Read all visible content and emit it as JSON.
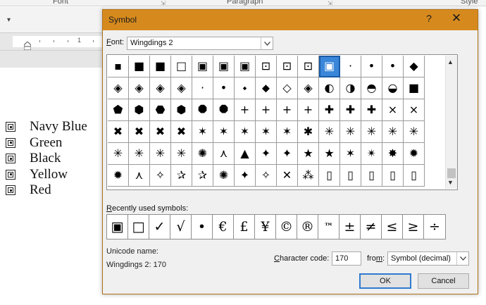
{
  "ribbon": {
    "groups": [
      "Font",
      "Paragraph",
      "Style"
    ],
    "collapse_icon": "qat-chevron-icon"
  },
  "ruler": {
    "number": "1"
  },
  "document": {
    "bullets": [
      "Navy Blue",
      "Green",
      "Black",
      "Yellow",
      "Red"
    ],
    "bullet_icon": "wingdings2-boxed-square-icon"
  },
  "dialog": {
    "title": "Symbol",
    "help_label": "?",
    "close_label": "✕",
    "font_label_u": "F",
    "font_label_rest": "ont:",
    "font_value": "Wingdings 2",
    "recent_label_u": "R",
    "recent_label_rest": "ecently used symbols:",
    "unicode_name_label": "Unicode name:",
    "unicode_name_value": "Wingdings 2: 170",
    "char_code_label_u": "C",
    "char_code_label_rest": "haracter code:",
    "char_code_value": "170",
    "from_label_rest": "fro",
    "from_label_u": "m",
    "from_label_end": ":",
    "from_value": "Symbol (decimal)",
    "ok_label": "OK",
    "cancel_label": "Cancel"
  },
  "symbols": [
    [
      "▪",
      "■",
      "■",
      "□",
      "▣",
      "▣",
      "▣",
      "⊡",
      "⊡",
      "⊡",
      "▣",
      "·",
      "•",
      "•",
      "◆",
      "◇"
    ],
    [
      "◈",
      "◈",
      "◈",
      "◈",
      "·",
      "•",
      "⬩",
      "⬥",
      "◇",
      "◈",
      "◐",
      "◑",
      "◓",
      "◒",
      "■",
      "◆"
    ],
    [
      "⬟",
      "⬢",
      "⬣",
      "⬢",
      "⯃",
      "⯃",
      "+",
      "+",
      "+",
      "+",
      "✚",
      "✚",
      "✚",
      "×",
      "×",
      "✕"
    ],
    [
      "✖",
      "✖",
      "✖",
      "✖",
      "✶",
      "✶",
      "✶",
      "✶",
      "✶",
      "✱",
      "✳",
      "✳",
      "✳",
      "✳",
      "✳",
      "✱"
    ],
    [
      "✳",
      "✳",
      "✳",
      "✳",
      "✺",
      "⋏",
      "▲",
      "✦",
      "✦",
      "★",
      "★",
      "✶",
      "✴",
      "✸",
      "✹",
      "✹"
    ],
    [
      "✹",
      "⋏",
      "✧",
      "✰",
      "✰",
      "✺",
      "✦",
      "✧",
      "✕",
      "⁂",
      "▯",
      "▯",
      "▯",
      "▯",
      "▯",
      "▯"
    ]
  ],
  "selected_symbol": {
    "row": 0,
    "col": 10,
    "label": "Wingdings 2: 170"
  },
  "recent_symbols": [
    "▣",
    "□",
    "✓",
    "√",
    "•",
    "€",
    "£",
    "¥",
    "©",
    "®",
    "™",
    "±",
    "≠",
    "≤",
    "≥",
    "÷"
  ],
  "colors": {
    "titlebar": "#d68a1e",
    "selection": "#3a86d8",
    "ok_border": "#2f7ad1"
  }
}
